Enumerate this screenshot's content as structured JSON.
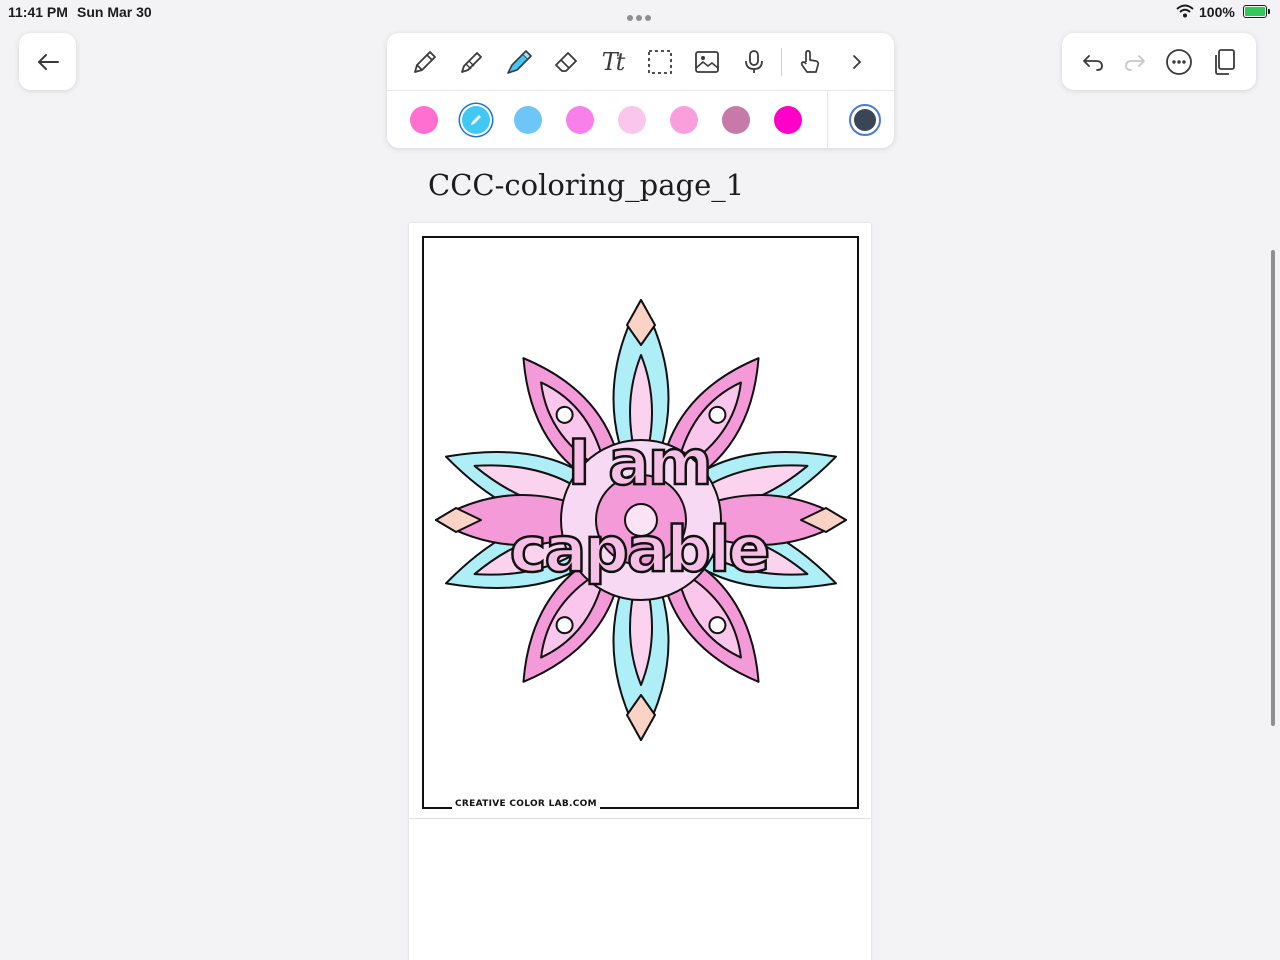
{
  "status_bar": {
    "time": "11:41 PM",
    "date": "Sun Mar 30",
    "battery": "100%"
  },
  "toolbar": {
    "tools": [
      {
        "name": "pen"
      },
      {
        "name": "pencil"
      },
      {
        "name": "highlighter"
      },
      {
        "name": "eraser"
      },
      {
        "name": "text",
        "label": "Tt"
      },
      {
        "name": "lasso"
      },
      {
        "name": "image"
      },
      {
        "name": "microphone"
      },
      {
        "name": "touch-draw"
      },
      {
        "name": "more-tools"
      }
    ],
    "colors": [
      "#ff6fd0",
      "#41c8f5",
      "#6ec6f7",
      "#f97fea",
      "#fbc6ec",
      "#f9a0dc",
      "#c77aa7",
      "#ff00c8"
    ],
    "selected_color_index": 1,
    "current_color": "#3a4655"
  },
  "document": {
    "title": "CCC-coloring_page_1",
    "affirmation_line1": "I am",
    "affirmation_line2": "capable",
    "credit": "CREATIVE COLOR LAB.COM"
  }
}
